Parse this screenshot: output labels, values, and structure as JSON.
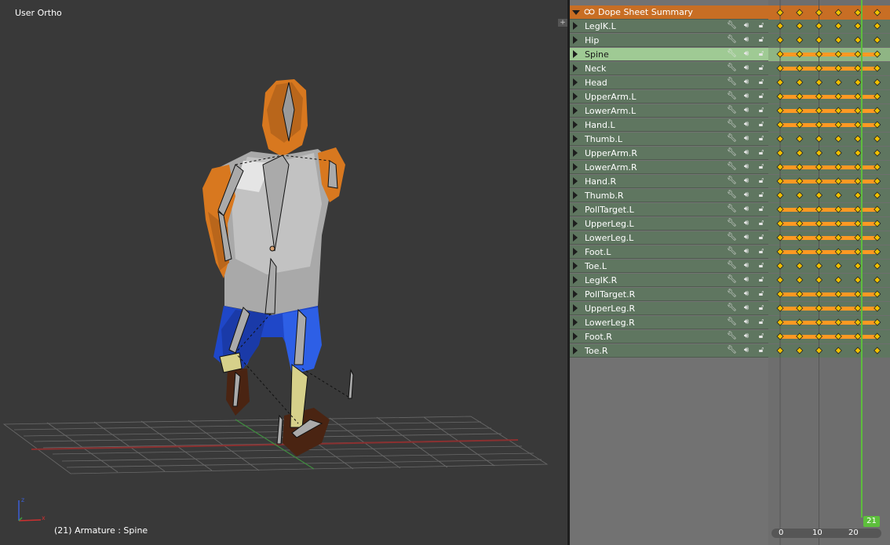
{
  "viewport": {
    "title": "User Ortho",
    "status": "(21) Armature : Spine",
    "axis_labels": {
      "x": "x",
      "z": "z"
    }
  },
  "colors": {
    "summary_row": "#c86e24",
    "bone_row": "#5f7660",
    "selected_row": "#9fca94",
    "keyframe": "#f0c000",
    "hold_bar": "#ff9922",
    "current_frame": "#5dbf3c",
    "shirt": "#b0b0b0",
    "skin": "#d97a20",
    "pants": "#1a3fbf"
  },
  "dopesheet": {
    "summary_label": "Dope Sheet Summary",
    "channels": [
      {
        "name": "LegIK.L",
        "selected": false
      },
      {
        "name": "Hip",
        "selected": false
      },
      {
        "name": "Spine",
        "selected": true
      },
      {
        "name": "Neck",
        "selected": false
      },
      {
        "name": "Head",
        "selected": false
      },
      {
        "name": "UpperArm.L",
        "selected": false
      },
      {
        "name": "LowerArm.L",
        "selected": false
      },
      {
        "name": "Hand.L",
        "selected": false
      },
      {
        "name": "Thumb.L",
        "selected": false
      },
      {
        "name": "UpperArm.R",
        "selected": false
      },
      {
        "name": "LowerArm.R",
        "selected": false
      },
      {
        "name": "Hand.R",
        "selected": false
      },
      {
        "name": "Thumb.R",
        "selected": false
      },
      {
        "name": "PollTarget.L",
        "selected": false
      },
      {
        "name": "UpperLeg.L",
        "selected": false
      },
      {
        "name": "LowerLeg.L",
        "selected": false
      },
      {
        "name": "Foot.L",
        "selected": false
      },
      {
        "name": "Toe.L",
        "selected": false
      },
      {
        "name": "LegIK.R",
        "selected": false
      },
      {
        "name": "PollTarget.R",
        "selected": false
      },
      {
        "name": "UpperLeg.R",
        "selected": false
      },
      {
        "name": "LowerLeg.R",
        "selected": false
      },
      {
        "name": "Foot.R",
        "selected": false
      },
      {
        "name": "Toe.R",
        "selected": false
      }
    ],
    "timeline": {
      "current_frame": "21",
      "ticks": [
        "0",
        "10",
        "20"
      ],
      "key_frames": [
        0,
        5,
        10,
        15,
        20,
        25
      ]
    }
  }
}
